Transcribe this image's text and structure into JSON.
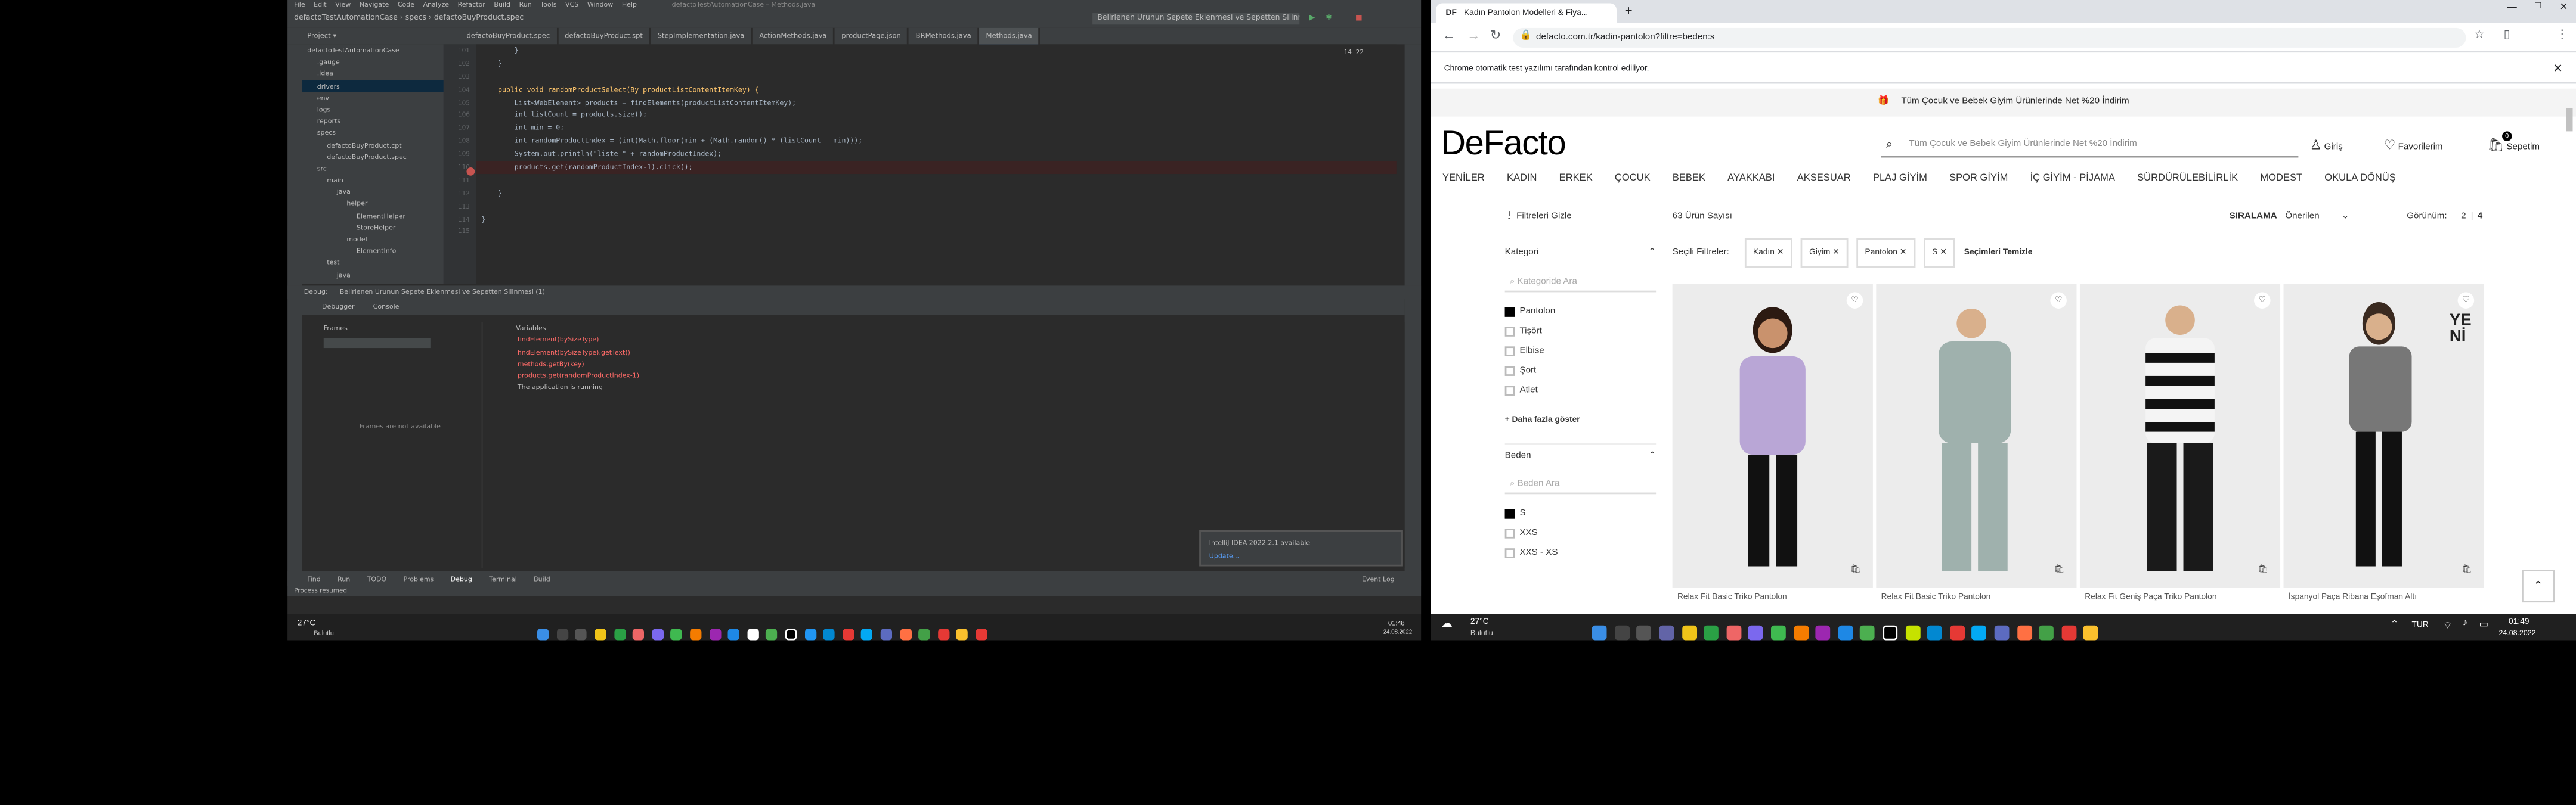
{
  "ide": {
    "title": "defactoTestAutomationCase – Methods.java",
    "menu": [
      "File",
      "Edit",
      "View",
      "Navigate",
      "Code",
      "Analyze",
      "Refactor",
      "Build",
      "Run",
      "Tools",
      "VCS",
      "Window",
      "Help"
    ],
    "breadcrumb": [
      "defactoTestAutomationCase",
      "specs",
      "defactoBuyProduct.spec"
    ],
    "run_config": "Belirlenen Urunun Sepete Eklenmesi ve Sepetten Silinmesi (1)",
    "project_label": "Project",
    "tabs": [
      "defactoBuyProduct.spec",
      "defactoBuyProduct.spt",
      "StepImplementation.java",
      "ActionMethods.java",
      "productPage.json",
      "BRMethods.java",
      "Methods.java"
    ],
    "tree": [
      "defactoTestAutomationCase",
      ".gauge",
      ".idea",
      "drivers",
      "env",
      "logs",
      "reports",
      "specs",
      "defactoBuyProduct.cpt",
      "defactoBuyProduct.spec",
      "src",
      "main",
      "java",
      "helper",
      "ElementHelper",
      "StoreHelper",
      "model",
      "ElementInfo",
      "test",
      "java"
    ],
    "line_numbers": [
      "101",
      "102",
      "103",
      "104",
      "105",
      "106",
      "107",
      "108",
      "109",
      "110",
      "111",
      "112",
      "113",
      "114",
      "115"
    ],
    "code_lines": [
      "        }",
      "    }",
      "",
      "    public void randomProductSelect(By productListContentItemKey) {",
      "        List<WebElement> products = findElements(productListContentItemKey);",
      "        int listCount = products.size();",
      "        int min = 0;",
      "        int randomProductIndex = (int)Math.floor(min + (Math.random() * (listCount - min)));",
      "        System.out.println(\"liste \" + randomProductIndex);",
      "        products.get(randomProductIndex-1).click();",
      "",
      "    }",
      "",
      "}",
      ""
    ],
    "warnings": "14  22",
    "debug_label": "Debug:",
    "debug_session": "Belirlenen Urunun Sepete Eklenmesi ve Sepetten Silinmesi (1)",
    "debug_tabs": [
      "Debugger",
      "Console"
    ],
    "frames_label": "Frames",
    "variables_label": "Variables",
    "frames_empty": "Frames are not available",
    "variables": [
      "findElement(bySizeType)",
      "findElement(bySizeType).getText()",
      "methods.getBy(key)",
      "products.get(randomProductIndex-1)",
      "The application is running"
    ],
    "notification_title": "IntelliJ IDEA 2022.2.1 available",
    "notification_link": "Update...",
    "toolwindows": [
      "Find",
      "Run",
      "TODO",
      "Problems",
      "Debug",
      "Terminal",
      "Build"
    ],
    "event_log": "Event Log",
    "status": "Process resumed"
  },
  "taskbar_left": {
    "temp": "27°C",
    "weather": "Bulutlu",
    "time": "01:48",
    "date": "24.08.2022"
  },
  "taskbar_right": {
    "temp": "27°C",
    "weather": "Bulutlu",
    "lang": "TUR",
    "time": "01:49",
    "date": "24.08.2022"
  },
  "browser": {
    "tab_title": "Kadın Pantolon Modelleri & Fiya...",
    "tab_favicon": "DF",
    "url": "defacto.com.tr/kadin-pantolon?filtre=beden:s",
    "infobar": "Chrome otomatik test yazılımı tarafından kontrol ediliyor."
  },
  "site": {
    "promo": "Tüm Çocuk ve Bebek Giyim Ürünlerinde Net %20 İndirim",
    "logo": "DeFacto",
    "search_placeholder": "Tüm Çocuk ve Bebek Giyim Ürünlerinde Net %20 İndirim",
    "login": "Giriş",
    "favorites": "Favorilerim",
    "cart": "Sepetim",
    "cart_count": "0",
    "menu": [
      "YENİLER",
      "KADIN",
      "ERKEK",
      "ÇOCUK",
      "BEBEK",
      "AYAKKABI",
      "AKSESUAR",
      "PLAJ GİYİM",
      "SPOR GİYİM",
      "İÇ GİYİM - PİJAMA",
      "SÜRDÜRÜLEBİLİRLİK",
      "MODEST",
      "OKULA DÖNÜŞ"
    ],
    "hide_filters": "Filtreleri Gizle",
    "product_count": "63 Ürün Sayısı",
    "sort_label": "SIRALAMA",
    "sort_value": "Önerilen",
    "view_label": "Görünüm:",
    "view_options": [
      "2",
      "4"
    ],
    "category_title": "Kategori",
    "category_search": "Kategoride Ara",
    "categories": [
      {
        "label": "Pantolon",
        "checked": true
      },
      {
        "label": "Tişört",
        "checked": false
      },
      {
        "label": "Elbise",
        "checked": false
      },
      {
        "label": "Şort",
        "checked": false
      },
      {
        "label": "Atlet",
        "checked": false
      }
    ],
    "show_more": "+ Daha fazla göster",
    "size_title": "Beden",
    "size_search": "Beden Ara",
    "sizes": [
      {
        "label": "S",
        "checked": true
      },
      {
        "label": "XXS",
        "checked": false
      },
      {
        "label": "XXS - XS",
        "checked": false
      }
    ],
    "selected_filters_label": "Seçili Filtreler:",
    "selected_filters": [
      "Kadın",
      "Giyim",
      "Pantolon",
      "S"
    ],
    "clear_filters": "Seçimleri Temizle",
    "new_badge": "YENİ",
    "products": [
      {
        "name": "Relax Fit Basic Triko Pantolon",
        "color": "#b9a6d6"
      },
      {
        "name": "Relax Fit Basic Triko Pantolon",
        "color": "#9fb1ad"
      },
      {
        "name": "Relax Fit Geniş Paça Triko Pantolon",
        "color": "#2b2b2b"
      },
      {
        "name": "İspanyol Paça Ribana Eşofman Altı",
        "color": "#777777"
      }
    ]
  }
}
